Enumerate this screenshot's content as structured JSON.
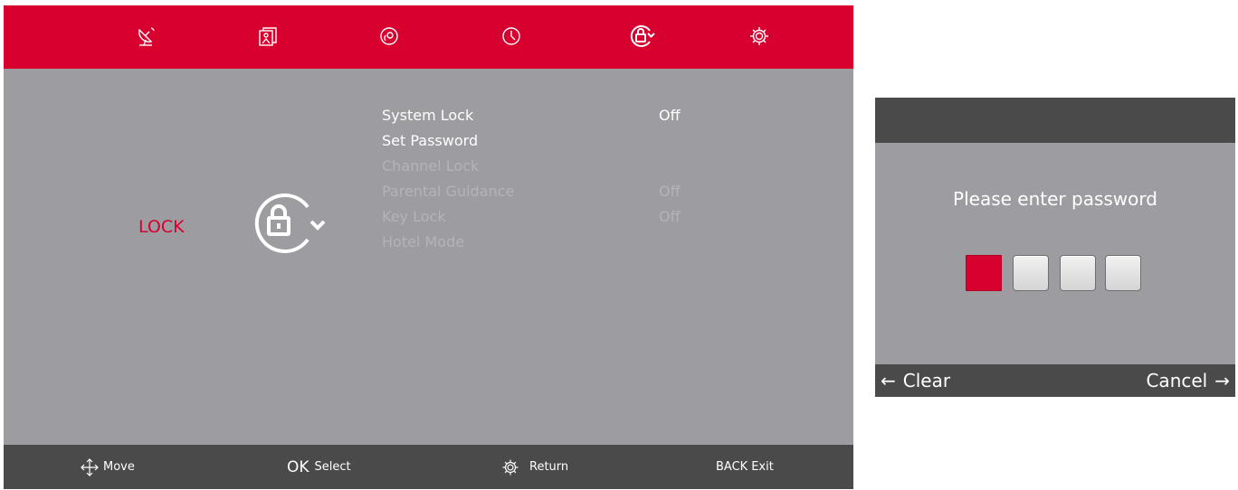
{
  "colors": {
    "accent": "#d7002f",
    "panel": "#9c9ca1",
    "bar": "#4a4a4a",
    "text_enabled": "#ffffff",
    "text_disabled": "#b4b4b8"
  },
  "top_tabs": [
    {
      "icon": "satellite-dish-icon"
    },
    {
      "icon": "picture-icon"
    },
    {
      "icon": "sound-icon"
    },
    {
      "icon": "clock-icon"
    },
    {
      "icon": "lock-icon",
      "selected": true
    },
    {
      "icon": "settings-icon"
    }
  ],
  "section": {
    "title": "LOCK",
    "emblem_icon": "lock-emblem-icon"
  },
  "menu": {
    "items": [
      {
        "label": "System Lock",
        "value": "Off",
        "enabled": true
      },
      {
        "label": "Set Password",
        "value": "",
        "enabled": true
      },
      {
        "label": "Channel Lock",
        "value": "",
        "enabled": false
      },
      {
        "label": "Parental Guidance",
        "value": "Off",
        "enabled": false
      },
      {
        "label": "Key Lock",
        "value": "Off",
        "enabled": false
      },
      {
        "label": "Hotel Mode",
        "value": "",
        "enabled": false
      }
    ]
  },
  "footer": {
    "move": {
      "icon": "move-arrows-icon",
      "label": "Move"
    },
    "select": {
      "key": "OK",
      "label": "Select"
    },
    "return": {
      "icon": "settings-icon",
      "label": "Return"
    },
    "exit": {
      "key": "BACK",
      "label": "Exit"
    }
  },
  "dialog": {
    "prompt": "Please enter password",
    "pin_length": 4,
    "active_index": 0,
    "clear": {
      "arrow": "←",
      "label": "Clear"
    },
    "cancel": {
      "label": "Cancel",
      "arrow": "→"
    }
  }
}
